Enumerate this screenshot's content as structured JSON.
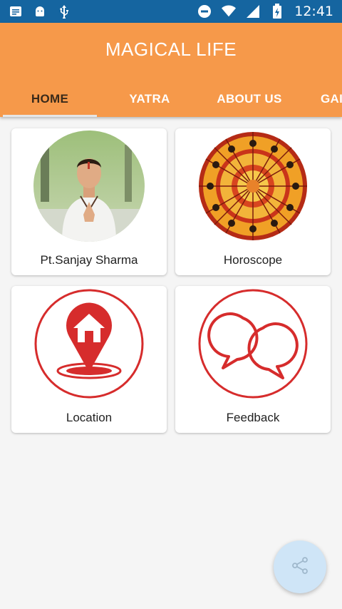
{
  "status_bar": {
    "time": "12:41",
    "icons": [
      "notification-icon",
      "android-icon",
      "usb-icon",
      "do-not-disturb-icon",
      "wifi-icon",
      "signal-icon",
      "battery-icon"
    ]
  },
  "app": {
    "title": "MAGICAL LIFE",
    "accent_color": "#f6994a"
  },
  "tabs": [
    {
      "label": "HOME",
      "active": true
    },
    {
      "label": "YATRA",
      "active": false
    },
    {
      "label": "ABOUT US",
      "active": false
    },
    {
      "label": "GAI",
      "active": false
    }
  ],
  "cards": [
    {
      "label": "Pt.Sanjay Sharma",
      "icon": "portrait-photo"
    },
    {
      "label": "Horoscope",
      "icon": "zodiac-wheel-icon"
    },
    {
      "label": "Location",
      "icon": "location-pin-home-icon"
    },
    {
      "label": "Feedback",
      "icon": "chat-bubbles-icon"
    }
  ],
  "fab": {
    "icon": "share-icon",
    "color": "#cfe5f7"
  }
}
